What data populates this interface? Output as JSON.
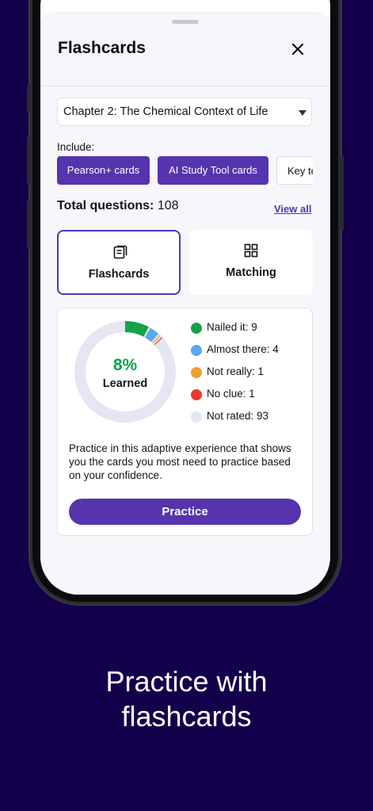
{
  "sheet": {
    "title": "Flashcards",
    "chapter_select": {
      "selected": "Chapter 2: The Chemical Context of Life"
    },
    "include_label": "Include:",
    "filter_chips": [
      {
        "label": "Pearson+ cards",
        "selected": true
      },
      {
        "label": "AI Study Tool cards",
        "selected": true
      },
      {
        "label": "Key terms",
        "selected": false
      }
    ],
    "total_label": "Total questions:",
    "total_count": "108",
    "view_all": "View all",
    "modes": [
      {
        "label": "Flashcards",
        "icon": "flashcards-icon",
        "selected": true
      },
      {
        "label": "Matching",
        "icon": "grid-icon",
        "selected": false
      }
    ],
    "progress": {
      "percent_text": "8%",
      "percent_value": 0.08,
      "learned_label": "Learned",
      "legend": [
        {
          "label": "Nailed it: 9",
          "count": 9,
          "color": "#14a34a"
        },
        {
          "label": "Almost there: 4",
          "count": 4,
          "color": "#5aa8ef"
        },
        {
          "label": "Not really: 1",
          "count": 1,
          "color": "#f0a02c"
        },
        {
          "label": "No clue: 1",
          "count": 1,
          "color": "#ea3a2e"
        },
        {
          "label": "Not rated: 93",
          "count": 93,
          "color": "#e6e5f2"
        }
      ],
      "description": "Practice in this adaptive experience that shows you the cards you most need to practice based on your confidence.",
      "practice_button": "Practice"
    }
  },
  "caption": {
    "line1": "Practice with",
    "line2": "flashcards"
  },
  "colors": {
    "accent": "#5534ad",
    "background": "#13004a",
    "learned_green": "#10a050"
  }
}
